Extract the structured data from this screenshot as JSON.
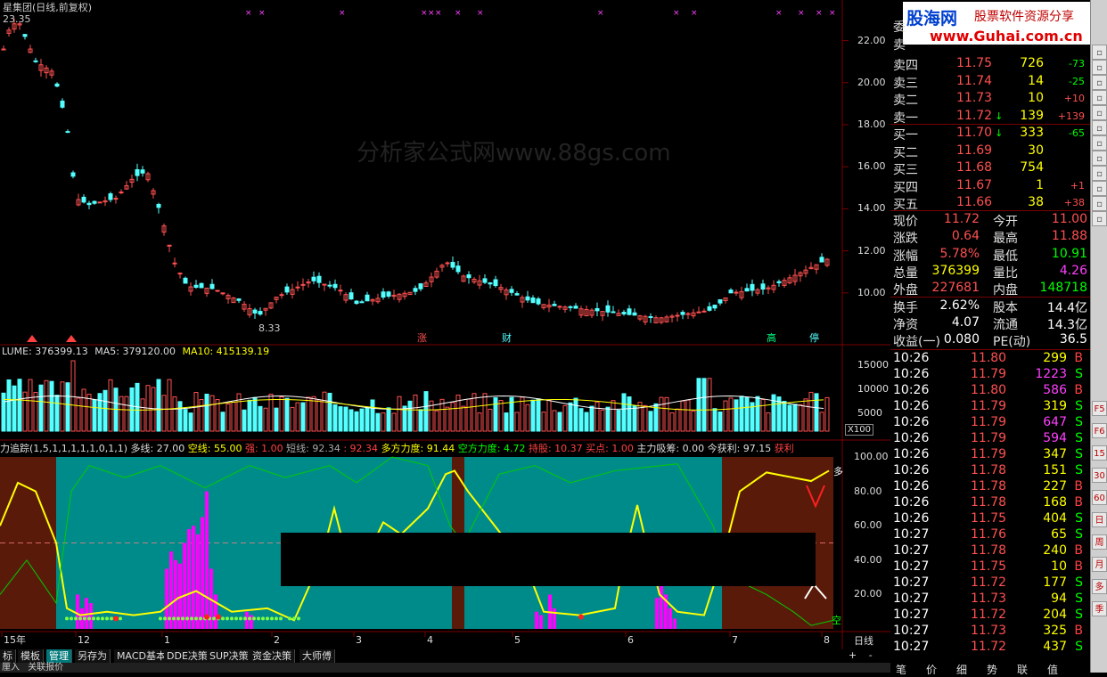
{
  "header": {
    "title": "星集团(日线,前复权)",
    "price_label": "23.35"
  },
  "watermark": "分析家公式网www.88gs.com",
  "price_axis": [
    "22.00",
    "20.00",
    "18.00",
    "16.00",
    "14.00",
    "12.00",
    "10.00"
  ],
  "price_low_label": "8.33",
  "event_marks": [
    "涨",
    "财",
    "高",
    "停"
  ],
  "volume": {
    "title": "LUME: 376399.13",
    "ma5": "MA5: 379120.00",
    "ma10": "MA10: 415139.19",
    "axis": [
      "15000",
      "10000",
      "5000"
    ],
    "unit": "X100"
  },
  "indicator": {
    "name": "力追踪(1,5,1,1,1,1,1,0,1,1)",
    "duo": "多线: 27.00",
    "kong": "空线: 55.00",
    "strong": "强: 1.00",
    "short": "短线: 92.34",
    "short2": ": 92.34",
    "duo_force": "多方力度: 91.44",
    "kong_force": "空方力度: 4.72",
    "hold": "持股: 10.37",
    "buy": "买点: 1.00",
    "absorb": "主力吸筹: 0.00",
    "profit": "今获利: 97.15",
    "profit_tag": "获利",
    "axis": [
      "100.00",
      "80.00",
      "60.00",
      "40.00",
      "20.00"
    ],
    "right_top": "多",
    "right_bottom": "空"
  },
  "date_axis": [
    "15年",
    "12",
    "1",
    "2",
    "3",
    "4",
    "5",
    "6",
    "7",
    "8"
  ],
  "date_unit": "日线",
  "toolbar": [
    "标",
    "模板",
    "管理",
    "另存为",
    "MACD基本",
    "DDE决策",
    "SUP决策",
    "资金决策",
    "大师傅"
  ],
  "bottom_status": [
    "厘入",
    "关联报价"
  ],
  "brand": {
    "name": "股海网",
    "slogan": "股票软件资源分享",
    "url": "www.Guhai.com.cn"
  },
  "order_book": {
    "top_labels": [
      "委",
      "卖"
    ],
    "asks": [
      {
        "label": "卖四",
        "price": "11.75",
        "vol": "726",
        "chg": "-73"
      },
      {
        "label": "卖三",
        "price": "11.74",
        "vol": "14",
        "chg": "-25"
      },
      {
        "label": "卖二",
        "price": "11.73",
        "vol": "10",
        "chg": "+10"
      },
      {
        "label": "卖一",
        "price": "11.72",
        "vol": "139",
        "chg": "+139"
      }
    ],
    "bids": [
      {
        "label": "买一",
        "price": "11.70",
        "vol": "333",
        "chg": "-65"
      },
      {
        "label": "买二",
        "price": "11.69",
        "vol": "30",
        "chg": ""
      },
      {
        "label": "买三",
        "price": "11.68",
        "vol": "754",
        "chg": ""
      },
      {
        "label": "买四",
        "price": "11.67",
        "vol": "1",
        "chg": "+1"
      },
      {
        "label": "买五",
        "price": "11.66",
        "vol": "38",
        "chg": "+38"
      }
    ]
  },
  "quote": [
    {
      "l1": "现价",
      "v1": "11.72",
      "l2": "今开",
      "v2": "11.00"
    },
    {
      "l1": "涨跌",
      "v1": "0.64",
      "l2": "最高",
      "v2": "11.88"
    },
    {
      "l1": "涨幅",
      "v1": "5.78%",
      "l2": "最低",
      "v2": "10.91"
    },
    {
      "l1": "总量",
      "v1": "376399",
      "l2": "量比",
      "v2": "4.26"
    },
    {
      "l1": "外盘",
      "v1": "227681",
      "l2": "内盘",
      "v2": "148718"
    }
  ],
  "fundamentals": [
    {
      "l1": "换手",
      "v1": "2.62%",
      "l2": "股本",
      "v2": "14.4亿"
    },
    {
      "l1": "净资",
      "v1": "4.07",
      "l2": "流通",
      "v2": "14.3亿"
    },
    {
      "l1": "收益(一)",
      "v1": "0.080",
      "l2": "PE(动)",
      "v2": "36.5"
    }
  ],
  "ticks": [
    {
      "t": "10:26",
      "p": "11.80",
      "v": "299",
      "bs": "B"
    },
    {
      "t": "10:26",
      "p": "11.79",
      "v": "1223",
      "bs": "S"
    },
    {
      "t": "10:26",
      "p": "11.80",
      "v": "586",
      "bs": "B"
    },
    {
      "t": "10:26",
      "p": "11.79",
      "v": "319",
      "bs": "S"
    },
    {
      "t": "10:26",
      "p": "11.79",
      "v": "647",
      "bs": "S"
    },
    {
      "t": "10:26",
      "p": "11.79",
      "v": "594",
      "bs": "S"
    },
    {
      "t": "10:26",
      "p": "11.79",
      "v": "347",
      "bs": "S"
    },
    {
      "t": "10:26",
      "p": "11.78",
      "v": "151",
      "bs": "S"
    },
    {
      "t": "10:26",
      "p": "11.78",
      "v": "227",
      "bs": "B"
    },
    {
      "t": "10:26",
      "p": "11.78",
      "v": "168",
      "bs": "B"
    },
    {
      "t": "10:26",
      "p": "11.75",
      "v": "404",
      "bs": "S"
    },
    {
      "t": "10:27",
      "p": "11.76",
      "v": "65",
      "bs": "S"
    },
    {
      "t": "10:27",
      "p": "11.78",
      "v": "240",
      "bs": "B"
    },
    {
      "t": "10:27",
      "p": "11.75",
      "v": "10",
      "bs": "B"
    },
    {
      "t": "10:27",
      "p": "11.72",
      "v": "177",
      "bs": "S"
    },
    {
      "t": "10:27",
      "p": "11.73",
      "v": "94",
      "bs": "S"
    },
    {
      "t": "10:27",
      "p": "11.72",
      "v": "204",
      "bs": "S"
    },
    {
      "t": "10:27",
      "p": "11.73",
      "v": "325",
      "bs": "B"
    },
    {
      "t": "10:27",
      "p": "11.72",
      "v": "437",
      "bs": "S"
    }
  ],
  "bottom_tabs": [
    "笔",
    "价",
    "细",
    "势",
    "联",
    "值"
  ],
  "side_buttons": [
    "F5",
    "F6",
    "15",
    "30",
    "60",
    "日",
    "周",
    "月",
    "多",
    "季"
  ],
  "colors": {
    "up": "#ff5050",
    "down": "#54ffff",
    "yellow": "#ffff00",
    "teal": "#008b8b",
    "maroon": "#5a1a0a",
    "magenta": "#ff00ff",
    "green": "#00cc00"
  }
}
